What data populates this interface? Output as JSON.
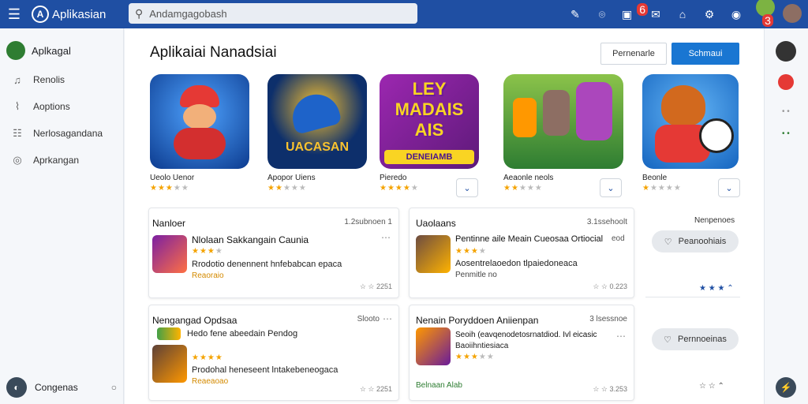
{
  "app": {
    "title": "Aplikasian"
  },
  "search": {
    "value": "Andamgagobash"
  },
  "topbar": {
    "badge1": "6",
    "badge2": "3"
  },
  "sidebar": {
    "user": "Aplkagal",
    "items": [
      {
        "label": "Renolis",
        "icon": "bell-icon"
      },
      {
        "label": "Aoptions",
        "icon": "chart-icon"
      },
      {
        "label": "Nerlosagandana",
        "icon": "list-icon"
      },
      {
        "label": "Aprkangan",
        "icon": "circle-icon"
      }
    ],
    "bottom": "Congenas"
  },
  "main": {
    "title": "Aplikaiai Nanadsiai",
    "btn_secondary": "Pernenarle",
    "btn_primary": "Schmaui"
  },
  "featured": [
    {
      "name": "Ueolo Uenor",
      "rating": 3,
      "colors": [
        "#1e63c9",
        "#e53935"
      ]
    },
    {
      "name": "Apopor Uiens",
      "rating": 2,
      "colors": [
        "#0d2f6b",
        "#f9c22e"
      ],
      "art_text": "UACASAN"
    },
    {
      "name": "Pieredo",
      "rating": 4,
      "colors": [
        "#7b1fa2",
        "#f9d423"
      ],
      "art_text": "LEY MADAIS AIS",
      "art_text2": "DENEIAMB"
    },
    {
      "name": "Aeaonle neols",
      "rating": 2,
      "colors": [
        "#43a047",
        "#ab47bc"
      ]
    },
    {
      "name": "Beonle",
      "rating": 1,
      "colors": [
        "#1e88e5",
        "#e53935"
      ]
    }
  ],
  "cards": [
    {
      "header": "Nanloer",
      "header_right": "1.2subnoen 1",
      "title": "Nlolaan Sakkangain Caunia",
      "stars": 3,
      "desc": "Rrodotio denennent hnfebabcan epaca",
      "meta": "Reaoraio",
      "foot": "2251"
    },
    {
      "header": "Uaolaans",
      "header_right": "3.1ssehoolt",
      "title": "Pentinne aile Meain Cueosaa Ortiocial",
      "title_right": "eod",
      "stars": 3,
      "desc": "Aosentrelaoedon tlpaiedoneaca",
      "meta": "Penmitle no",
      "foot": "0.223"
    },
    {
      "header": "Nengangad Opdsaa",
      "header_right": "Slooto",
      "title": "Hedo fene abeedain Pendog",
      "stars": 4,
      "desc": "Prodohal heneseent lntakebeneogaca",
      "meta": "Reaeaoao",
      "foot": "2251"
    },
    {
      "header": "Nenain Poryddoen Aniienpan",
      "header_right": "3 lsessnoe",
      "title": "Seoih (eavqenodetosrnatdiod. Ivl eicasic",
      "title2": "Baoiihntiesiaca",
      "stars": 3,
      "meta": "Belnaan Alab",
      "foot": "3.253"
    }
  ],
  "side_panel": {
    "label": "Nenpenoes",
    "pill1": "Peanoohiais",
    "pill2": "Pernnoeinas",
    "rating1": "★ ★ ★"
  }
}
